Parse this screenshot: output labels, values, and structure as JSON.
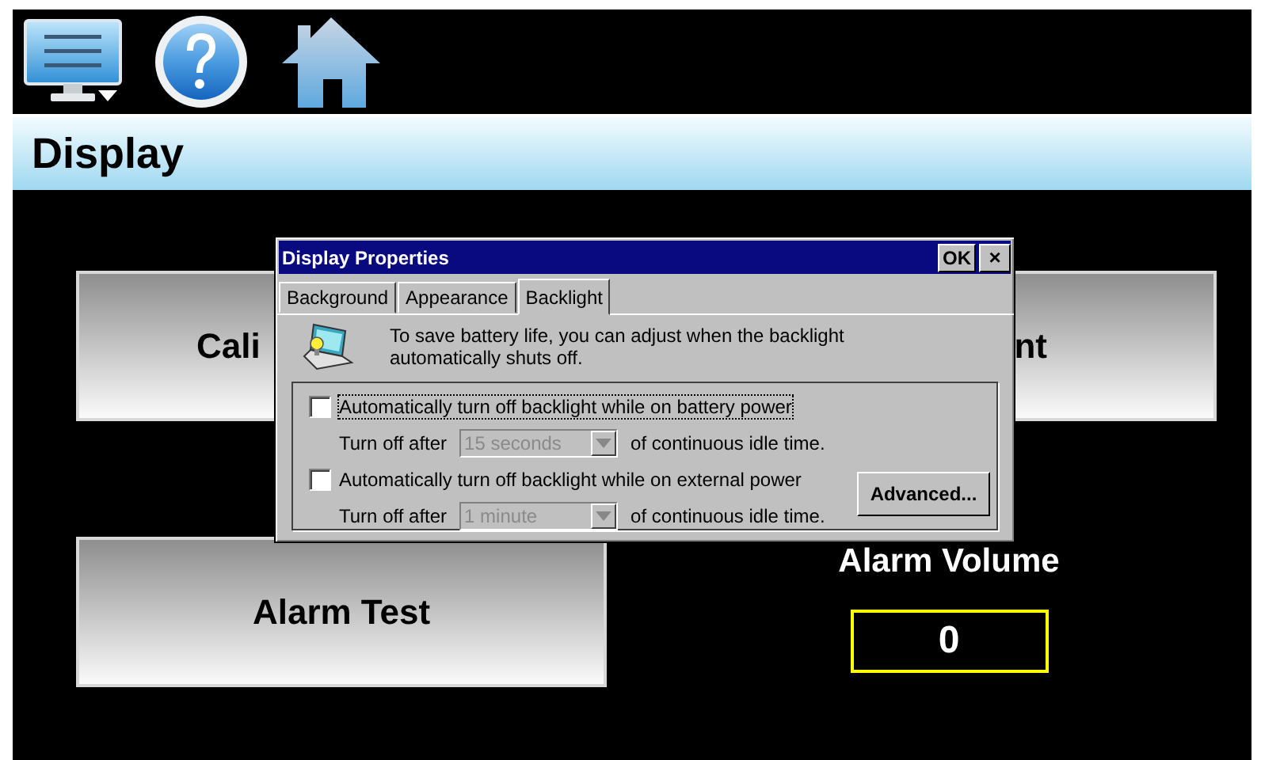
{
  "header": {
    "title": "Display"
  },
  "buttons": [
    {
      "label": "Cali"
    },
    {
      "label": "nt"
    },
    {
      "label": "Alarm Test"
    }
  ],
  "alarm_volume": {
    "label": "Alarm Volume",
    "value": "0"
  },
  "dialog": {
    "title": "Display Properties",
    "ok": "OK",
    "close": "×",
    "tabs": [
      {
        "label": "Background",
        "selected": false
      },
      {
        "label": "Appearance",
        "selected": false
      },
      {
        "label": "Backlight",
        "selected": true
      }
    ],
    "description": "To save battery life, you can adjust when the backlight automatically shuts off.",
    "options": [
      {
        "label": "Automatically turn off backlight while on battery power",
        "checked": false,
        "prefix": "Turn off after",
        "value": "15 seconds",
        "disabled": true,
        "suffix": "of continuous idle time."
      },
      {
        "label": "Automatically turn off backlight while on external power",
        "checked": false,
        "prefix": "Turn off after",
        "value": "1 minute",
        "disabled": true,
        "suffix": "of continuous idle time."
      }
    ],
    "advanced": "Advanced..."
  }
}
